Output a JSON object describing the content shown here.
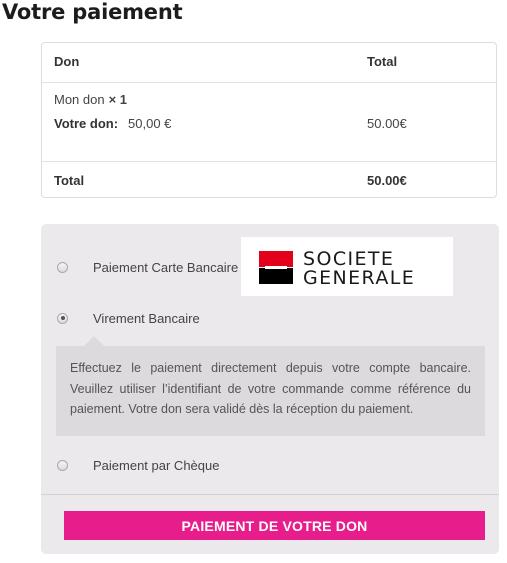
{
  "page_title": "Votre paiement",
  "order": {
    "headers": {
      "col1": "Don",
      "col2": "Total"
    },
    "item": {
      "name": "Mon don",
      "quantity": "× 1",
      "meta_label": "Votre don:",
      "meta_value": "50,00 €",
      "total": "50.00€"
    },
    "total_label": "Total",
    "total_value": "50.00€"
  },
  "payment": {
    "methods": [
      {
        "label": "Paiement Carte Bancaire",
        "checked": false
      },
      {
        "label": "Virement Bancaire",
        "checked": true
      },
      {
        "label": "Paiement par Chèque",
        "checked": false
      }
    ],
    "logo": {
      "line1": "SOCIETE",
      "line2": "GENERALE",
      "colors": {
        "red": "#e2001a",
        "black": "#000000"
      }
    },
    "description": "Effectuez le paiement directement depuis votre compte bancaire. Veuillez utiliser l’identifiant de votre commande comme référence du paiement. Votre don sera validé dès la réception du paiement.",
    "submit_label": "PAIEMENT DE VOTRE DON",
    "accent_color": "#e81d8c"
  }
}
